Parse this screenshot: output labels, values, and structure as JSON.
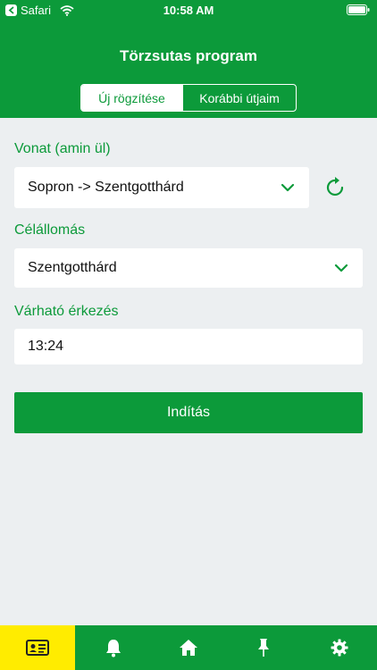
{
  "status_bar": {
    "back_app": "Safari",
    "time": "10:58 AM"
  },
  "header": {
    "title": "Törzsutas program",
    "tabs": [
      {
        "label": "Új rögzítése",
        "active": true
      },
      {
        "label": "Korábbi útjaim",
        "active": false
      }
    ]
  },
  "form": {
    "train": {
      "label": "Vonat (amin ül)",
      "value": "Sopron -> Szentgotthárd"
    },
    "destination": {
      "label": "Célállomás",
      "value": "Szentgotthárd"
    },
    "arrival": {
      "label": "Várható érkezés",
      "value": "13:24"
    },
    "start_label": "Indítás"
  },
  "tabbar": {
    "items": [
      {
        "icon": "id-card-icon",
        "active": true
      },
      {
        "icon": "bell-icon",
        "active": false
      },
      {
        "icon": "home-icon",
        "active": false
      },
      {
        "icon": "pin-icon",
        "active": false
      },
      {
        "icon": "gear-icon",
        "active": false
      }
    ]
  },
  "colors": {
    "brand_green": "#0c9a3a",
    "active_tab": "#ffec00",
    "background": "#eceff1"
  }
}
